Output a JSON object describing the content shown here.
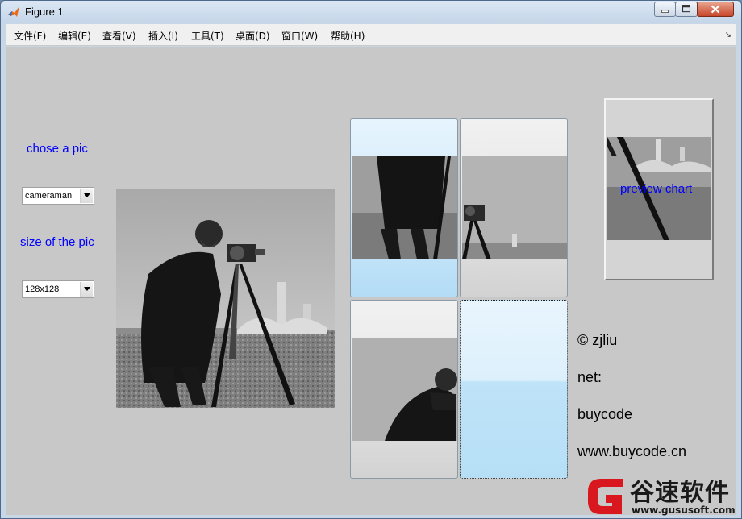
{
  "window": {
    "title": "Figure 1"
  },
  "menu": [
    "文件(F)",
    "编辑(E)",
    "查看(V)",
    "插入(I)",
    "工具(T)",
    "桌面(D)",
    "窗口(W)",
    "帮助(H)"
  ],
  "controls": {
    "chose_label": "chose a pic",
    "pic_select": "cameraman",
    "size_label": "size of the pic",
    "size_select": "128x128"
  },
  "preview": {
    "label": "preview chart"
  },
  "credits": {
    "author": "© zjliu",
    "net_label": "net:",
    "site_name": "buycode",
    "site_url": "www.buycode.cn"
  },
  "watermark": {
    "text": "谷速软件",
    "url": "www.gususoft.com"
  },
  "colors": {
    "accent_label": "#0000ff",
    "canvas": "#c8c8c8",
    "tile_blue": "#b3dcf6"
  }
}
